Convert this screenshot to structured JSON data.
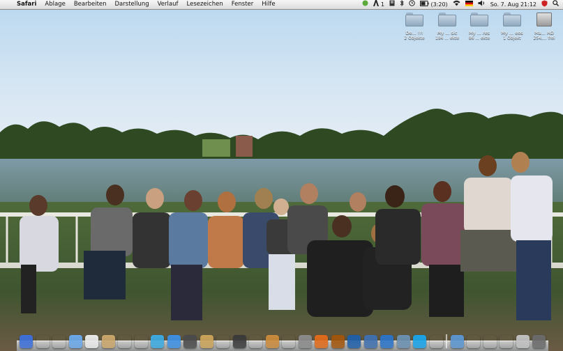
{
  "menubar": {
    "apple_glyph": "",
    "app_name": "Safari",
    "menus": [
      "Ablage",
      "Bearbeiten",
      "Darstellung",
      "Verlauf",
      "Lesezeichen",
      "Fenster",
      "Hilfe"
    ],
    "status": {
      "adobe_count": "1",
      "battery": "(3:20)",
      "clock": "So. 7. Aug  21:12"
    }
  },
  "desktop_icons": [
    {
      "label": "De... !!!",
      "sub": "2 Objekte"
    },
    {
      "label": "My ... sic",
      "sub": "184 ... ekte"
    },
    {
      "label": "My ... res",
      "sub": "86 ... ekte"
    },
    {
      "label": "My ... eos",
      "sub": "1 Objekt"
    },
    {
      "label": "Ma... HD",
      "sub": "254,... frei"
    }
  ],
  "dock": {
    "colors": [
      "#3c6fd8",
      "#444",
      "#c33",
      "#6aa8e8",
      "#e9e9e9",
      "#c9a66b",
      "#b33",
      "#666",
      "#3ca9e0",
      "#3d8fe3",
      "#4a4a4a",
      "#caa35a",
      "#c22",
      "#3a3a3a",
      "#777",
      "#c98a3b",
      "#4a8",
      "#8a8a8a",
      "#e06a1a",
      "#a1550c",
      "#1e5ea8",
      "#3f6fae",
      "#2b73c7",
      "#6a8fb0",
      "#1aa3e8",
      "#888",
      "#5b95d0",
      "#8aa",
      "#557",
      "#333",
      "#c0c0c0",
      "#6a6a6a"
    ]
  }
}
